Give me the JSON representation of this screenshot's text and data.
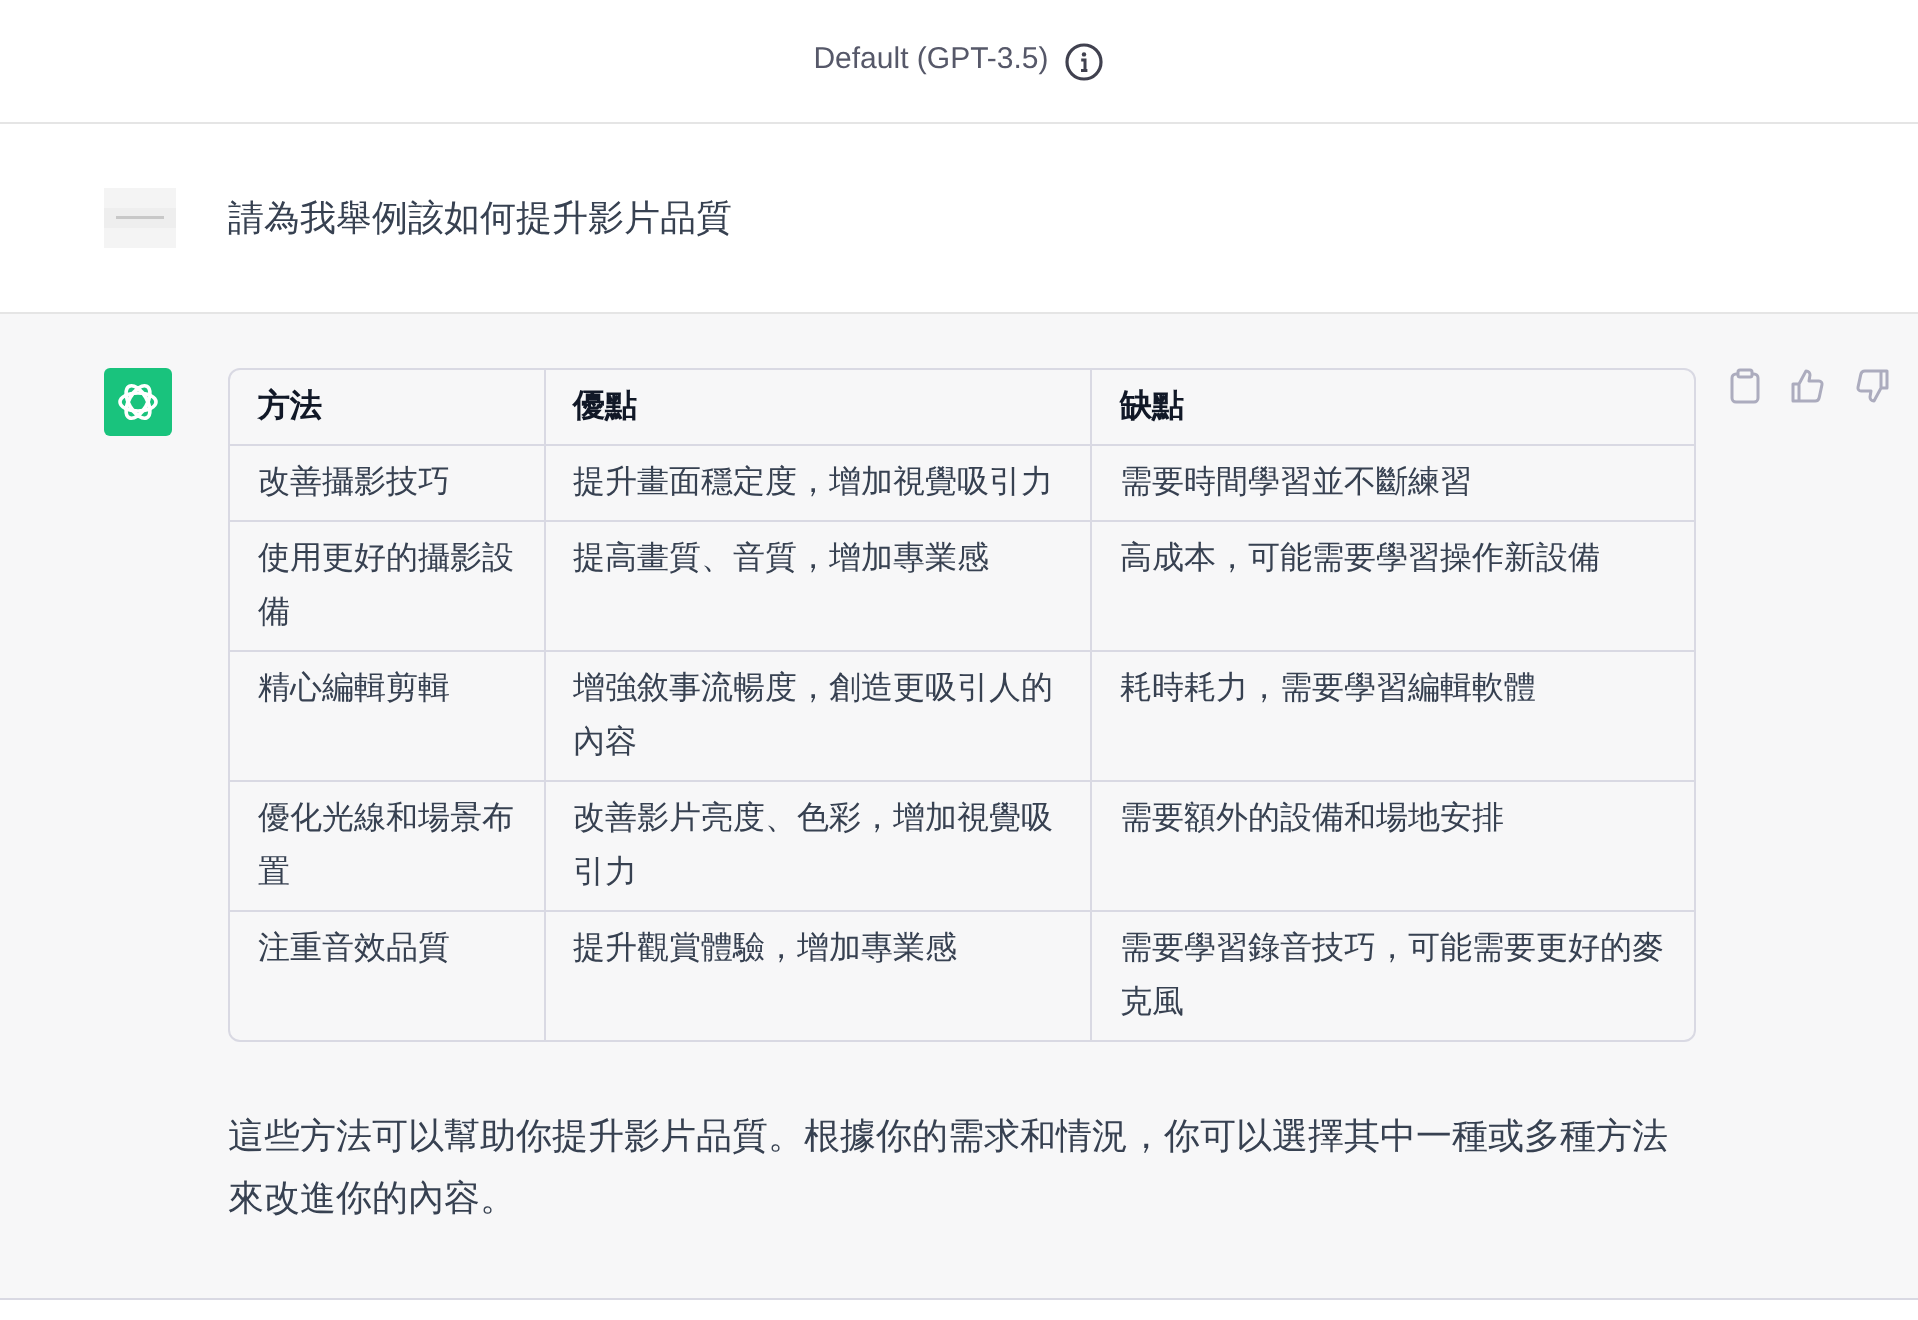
{
  "header": {
    "title": "Default (GPT-3.5)"
  },
  "user_message": {
    "text": "請為我舉例該如何提升影片品質"
  },
  "assistant_message": {
    "table": {
      "columns": [
        "方法",
        "優點",
        "缺點"
      ],
      "rows": [
        [
          "改善攝影技巧",
          "提升畫面穩定度，增加視覺吸引力",
          "需要時間學習並不斷練習"
        ],
        [
          "使用更好的攝影設備",
          "提高畫質、音質，增加專業感",
          "高成本，可能需要學習操作新設備"
        ],
        [
          "精心編輯剪輯",
          "增強敘事流暢度，創造更吸引人的內容",
          "耗時耗力，需要學習編輯軟體"
        ],
        [
          "優化光線和場景布置",
          "改善影片亮度、色彩，增加視覺吸引力",
          "需要額外的設備和場地安排"
        ],
        [
          "注重音效品質",
          "提升觀賞體驗，增加專業感",
          "需要學習錄音技巧，可能需要更好的麥克風"
        ]
      ]
    },
    "text": "這些方法可以幫助你提升影片品質。根據你的需求和情況，你可以選擇其中一種或多種方法來改進你的內容。"
  }
}
